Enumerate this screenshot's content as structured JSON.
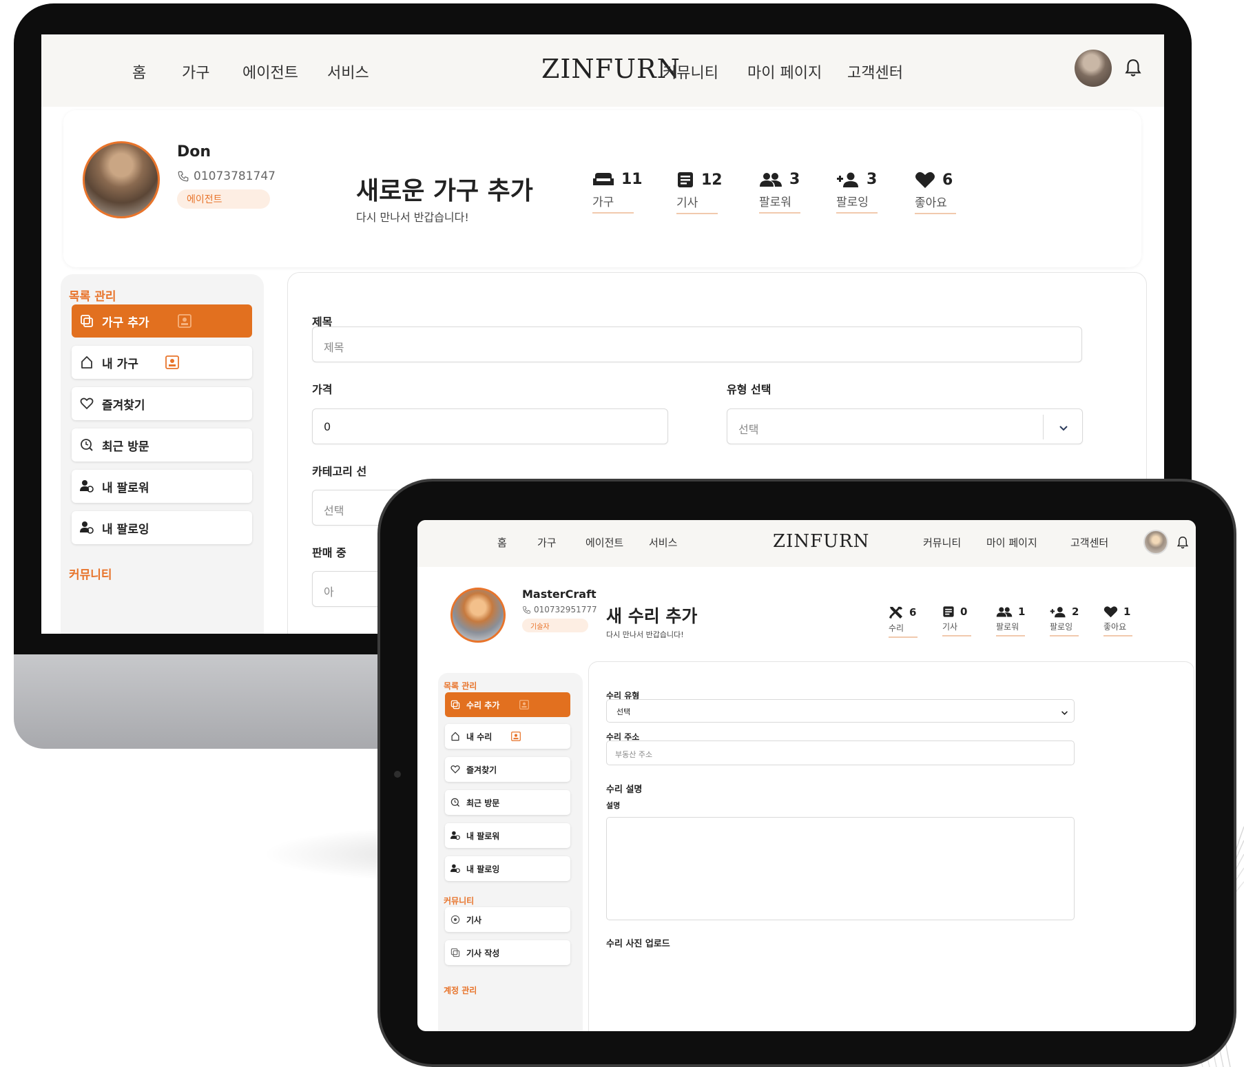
{
  "accent_color": "#e2701f",
  "desktop": {
    "nav": {
      "left_links": [
        "홈",
        "가구",
        "에이전트",
        "서비스"
      ],
      "logo": "ZINFURN",
      "right_links": [
        "커뮤니티",
        "마이 페이지",
        "고객센터"
      ]
    },
    "profile": {
      "name": "Don",
      "phone": "01073781747",
      "badge": "에이전트",
      "page_title": "새로운 가구 추가",
      "greeting": "다시 만나서 반갑습니다!",
      "stats": [
        {
          "icon": "sofa-icon",
          "value": "11",
          "label": "가구"
        },
        {
          "icon": "article-icon",
          "value": "12",
          "label": "기사"
        },
        {
          "icon": "followers-icon",
          "value": "3",
          "label": "팔로워"
        },
        {
          "icon": "person-add-icon",
          "value": "3",
          "label": "팔로잉"
        },
        {
          "icon": "heart-icon",
          "value": "6",
          "label": "좋아요"
        }
      ]
    },
    "sidebar": {
      "section_title": "목록 관리",
      "items": [
        {
          "label": "가구 추가",
          "icon": "copy-icon"
        },
        {
          "label": "내 가구",
          "icon": "home-icon"
        },
        {
          "label": "즐겨찾기",
          "icon": "heart-outline-icon"
        },
        {
          "label": "최근 방문",
          "icon": "search-history-icon"
        },
        {
          "label": "내 팔로워",
          "icon": "user-follow-icon"
        },
        {
          "label": "내 팔로잉",
          "icon": "user-follow-icon"
        }
      ],
      "community_title": "커뮤니티"
    },
    "form": {
      "title_label": "제목",
      "title_placeholder": "제목",
      "price_label": "가격",
      "price_value": "0",
      "type_label": "유형 선택",
      "type_placeholder": "선택",
      "category_label_partial": "카테고리 선",
      "category_placeholder_partial": "선택",
      "sale_label_partial": "판매 중",
      "sale_value_partial": "아"
    }
  },
  "tablet": {
    "nav": {
      "left_links": [
        "홈",
        "가구",
        "에이전트",
        "서비스"
      ],
      "logo": "ZINFURN",
      "right_links": [
        "커뮤니티",
        "마이 페이지",
        "고객센터"
      ]
    },
    "profile": {
      "name": "MasterCraft",
      "phone": "010732951777",
      "badge": "기술자",
      "page_title": "새 수리 추가",
      "greeting": "다시 만나서 반갑습니다!",
      "stats": [
        {
          "icon": "tools-icon",
          "value": "6",
          "label": "수리"
        },
        {
          "icon": "article-icon",
          "value": "0",
          "label": "기사"
        },
        {
          "icon": "followers-icon",
          "value": "1",
          "label": "팔로워"
        },
        {
          "icon": "person-add-icon",
          "value": "2",
          "label": "팔로잉"
        },
        {
          "icon": "heart-icon",
          "value": "1",
          "label": "좋아요"
        }
      ]
    },
    "sidebar": {
      "section_title": "목록 관리",
      "items": [
        {
          "label": "수리 추가",
          "icon": "copy-icon"
        },
        {
          "label": "내 수리",
          "icon": "home-icon"
        },
        {
          "label": "즐겨찾기",
          "icon": "heart-outline-icon"
        },
        {
          "label": "최근 방문",
          "icon": "search-history-icon"
        },
        {
          "label": "내 팔로워",
          "icon": "user-follow-icon"
        },
        {
          "label": "내 팔로잉",
          "icon": "user-follow-icon"
        }
      ],
      "community_title": "커뮤니티",
      "community_items": [
        {
          "label": "기사",
          "icon": "article-circle-icon"
        },
        {
          "label": "기사 작성",
          "icon": "copy-icon"
        }
      ],
      "account_title": "계정 관리"
    },
    "form": {
      "repair_type_label": "수리 유형",
      "repair_type_selected": "선택",
      "address_label": "수리 주소",
      "address_placeholder": "부동산 주소",
      "description_heading": "수리 설명",
      "description_label": "설명",
      "photo_upload_label": "수리 사진 업로드"
    }
  }
}
